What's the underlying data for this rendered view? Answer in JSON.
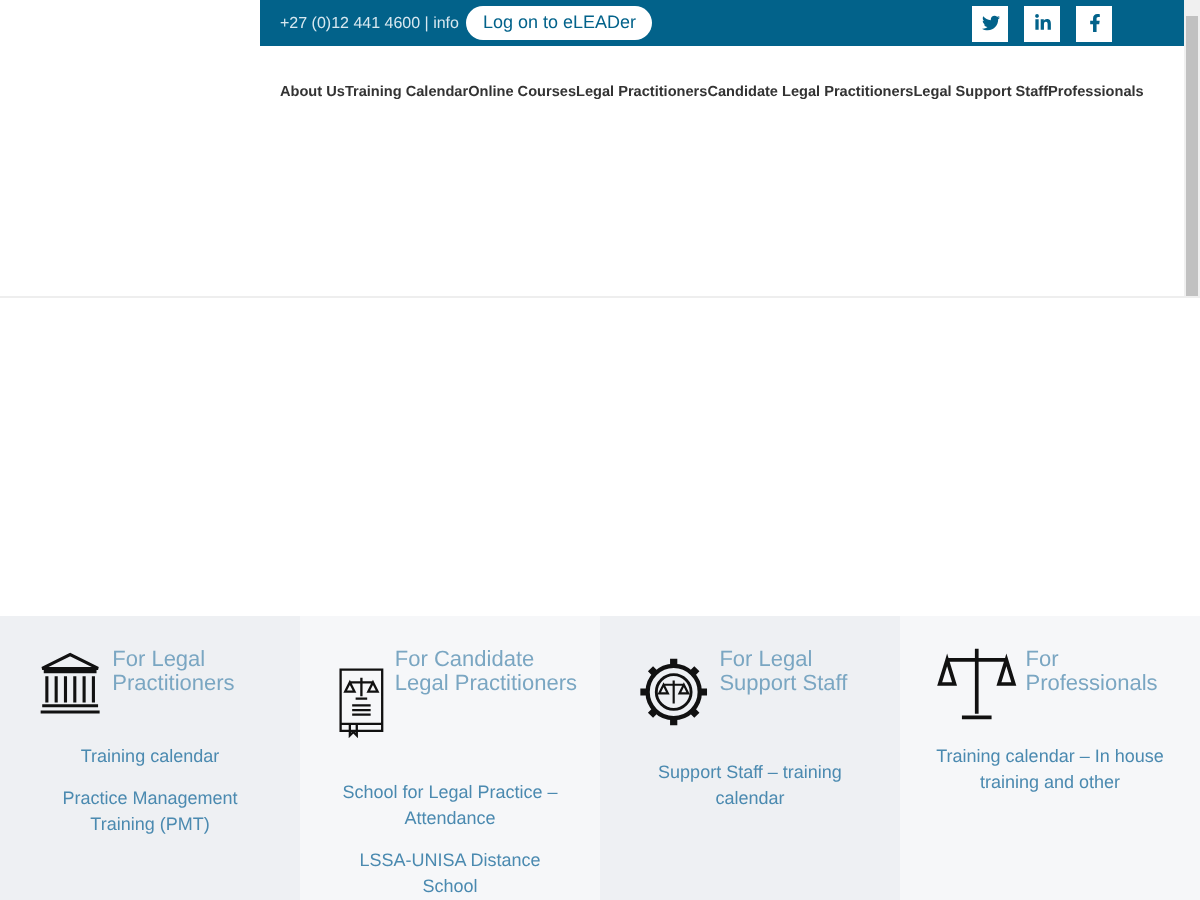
{
  "top_bar": {
    "contact": "+27 (0)12 441 4600 | info",
    "login_button": "Log on to eLEADer"
  },
  "nav": {
    "items": [
      "About Us",
      "Training Calendar",
      "Online Courses",
      "Legal Practitioners",
      "Candidate Legal Practitioners",
      "Legal Support Staff",
      "Professionals"
    ]
  },
  "cards": [
    {
      "kind": "building",
      "title": "For Legal Practitioners",
      "links": [
        "Training calendar",
        "Practice Management Training (PMT)"
      ]
    },
    {
      "kind": "book",
      "title": "For Candidate Legal Practitioners",
      "links": [
        "School for Legal Practice – Attendance",
        "LSSA-UNISA Distance School"
      ]
    },
    {
      "kind": "gear",
      "title": "For Legal Support Staff",
      "links": [
        "Support Staff – training calendar"
      ]
    },
    {
      "kind": "scales",
      "title": "For Professionals",
      "links": [
        "Training calendar – In house training  and other"
      ]
    }
  ]
}
